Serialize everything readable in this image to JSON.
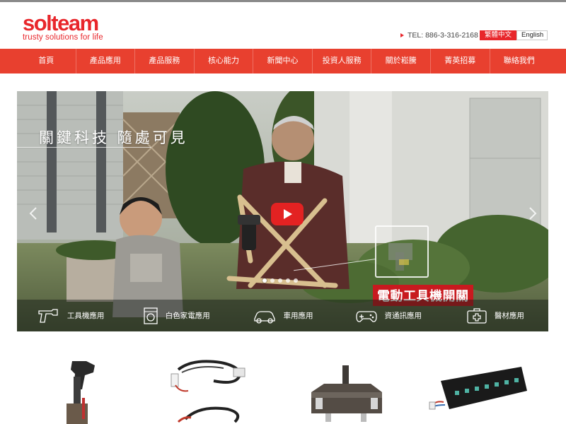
{
  "brand": {
    "name": "solteam",
    "tagline": "trusty solutions for life",
    "color": "#e8262b"
  },
  "contact": {
    "phone": "TEL: 886-3-316-2168"
  },
  "language": {
    "options": [
      "繁體中文",
      "English"
    ],
    "selected": "繁體中文"
  },
  "nav": {
    "items": [
      "首頁",
      "產品應用",
      "產品服務",
      "核心能力",
      "新聞中心",
      "投資人服務",
      "關於崧騰",
      "菁英招募",
      "聯絡我們"
    ],
    "color": "#e8402f"
  },
  "hero": {
    "tagline": "關鍵科技 隨處可見",
    "callout": "電動工具機開關",
    "slide_count": 5,
    "active_slide": 1,
    "applications": [
      {
        "label": "工具機應用",
        "icon": "power-drill-icon"
      },
      {
        "label": "白色家電應用",
        "icon": "washing-machine-icon"
      },
      {
        "label": "車用應用",
        "icon": "car-icon"
      },
      {
        "label": "資通訊應用",
        "icon": "gamepad-icon"
      },
      {
        "label": "醫材應用",
        "icon": "medical-kit-icon"
      }
    ]
  },
  "products": [
    {
      "icon": "trigger-switch-icon"
    },
    {
      "icon": "cable-harness-icon"
    },
    {
      "icon": "rotary-switch-icon"
    },
    {
      "icon": "control-panel-icon"
    }
  ]
}
